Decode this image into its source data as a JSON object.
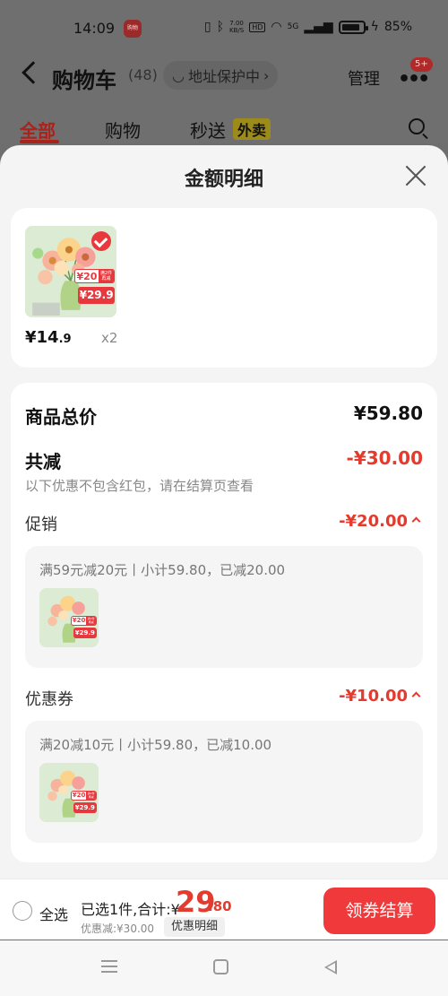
{
  "status_bar": {
    "time": "14:09",
    "app_badge": "购物",
    "network_speed_top": "7.00",
    "network_speed_bottom": "KB/S",
    "hd": "HD",
    "cellular": "5G",
    "battery": "85%",
    "battery_level": 0.85
  },
  "header": {
    "title": "购物车",
    "count": "(48)",
    "address": "地址保护中",
    "manage": "管理",
    "more_badge": "5+"
  },
  "tabs": [
    {
      "label": "全部",
      "active": true
    },
    {
      "label": "购物",
      "active": false
    },
    {
      "label": "秒送",
      "active": false
    }
  ],
  "takeaway_badge": "外卖",
  "sheet": {
    "title": "金额明细",
    "product": {
      "price_main": "¥14",
      "price_dec": ".9",
      "quantity": "x2",
      "tag_price": "¥20",
      "tag_label": "满2件再减",
      "tag_final": "¥29.9"
    },
    "detail": {
      "total_label": "商品总价",
      "total_value": "¥59.80",
      "reduce_label": "共减",
      "reduce_value": "-¥30.00",
      "note": "以下优惠不包含红包，请在结算页查看",
      "promo": {
        "label": "促销",
        "value": "-¥20.00",
        "desc": "满59元减20元丨小计59.80，已减20.00"
      },
      "coupon": {
        "label": "优惠券",
        "value": "-¥10.00",
        "desc": "满20减10元丨小计59.80，已减10.00"
      }
    }
  },
  "bottom_bar": {
    "select_all": "全选",
    "selected": "已选1件,合计:¥",
    "total_int": "29",
    "total_dec": ".80",
    "discount": "优惠减:¥30.00",
    "detail_button": "优惠明细",
    "checkout": "领券结算"
  },
  "colors": {
    "accent_red": "#e53a2e",
    "checkout_red": "#f0393a"
  }
}
